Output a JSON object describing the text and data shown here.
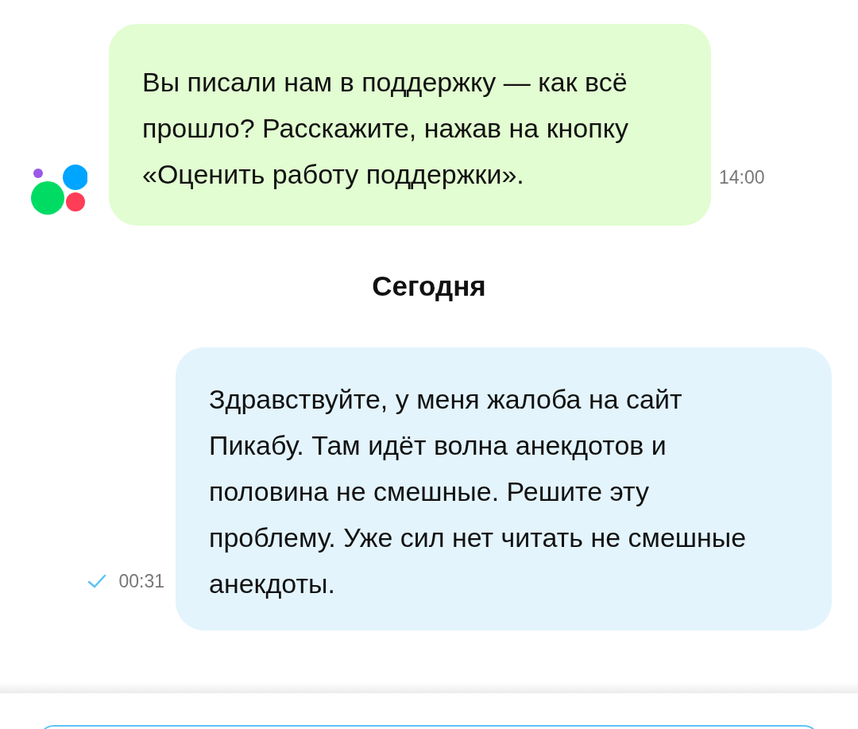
{
  "messages": [
    {
      "kind": "incoming",
      "text": "Вы писали нам в поддержку — как всё прошло? Расскажите, нажав на кнопку «Оценить работу поддержки».",
      "time": "14:00"
    },
    {
      "kind": "date",
      "text": "Сегодня"
    },
    {
      "kind": "outgoing",
      "text": "Здравствуйте, у меня жалоба на сайт Пикабу. Там идёт волна анекдотов и половина не смешные. Решите эту проблему. Уже сил нет читать не смешные анекдоты.",
      "time": "00:31",
      "delivered": true
    }
  ]
}
